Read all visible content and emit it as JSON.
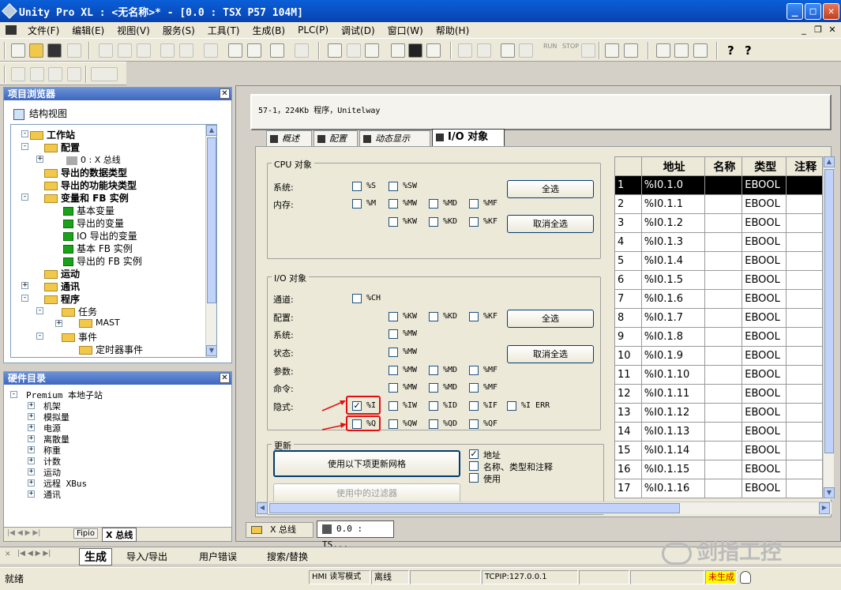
{
  "window": {
    "title": "Unity Pro XL : <无名称>* - [0.0 : TSX P57 104M]",
    "min": "_",
    "max": "□",
    "close": "✕"
  },
  "menu": [
    "文件(F)",
    "编辑(E)",
    "视图(V)",
    "服务(S)",
    "工具(T)",
    "生成(B)",
    "PLC(P)",
    "调试(D)",
    "窗口(W)",
    "帮助(H)"
  ],
  "toolbar": {
    "run_label": "RUN",
    "stop_label": "STOP"
  },
  "project_browser": {
    "title": "项目浏览器",
    "view": "结构视图",
    "items": [
      "工作站",
      "配置",
      "0 : X 总线",
      "导出的数据类型",
      "导出的功能块类型",
      "变量和 FB 实例",
      "基本变量",
      "导出的变量",
      "IO 导出的变量",
      "基本 FB 实例",
      "导出的 FB 实例",
      "运动",
      "通讯",
      "程序",
      "任务",
      "MAST",
      "事件",
      "定时器事件"
    ]
  },
  "hardware_catalog": {
    "title": "硬件目录",
    "root": "Premium 本地子站",
    "items": [
      "机架",
      "模拟量",
      "电源",
      "离散量",
      "称重",
      "计数",
      "运动",
      "远程 XBus",
      "通讯"
    ],
    "tabs": [
      "Fipio",
      "X 总线"
    ]
  },
  "module": {
    "description": "57-1，224Kb 程序，Unitelway",
    "tabs": [
      "概述",
      "配置",
      "动态显示",
      "I/O 对象"
    ]
  },
  "cpu_objects": {
    "title": "CPU 对象",
    "system_label": "系统:",
    "memory_label": "内存:",
    "sys_boxes": [
      "%S",
      "%SW"
    ],
    "mem_row1": [
      "%M",
      "%MW",
      "%MD",
      "%MF"
    ],
    "mem_row2": [
      "%KW",
      "%KD",
      "%KF"
    ],
    "select_all": "全选",
    "deselect_all": "取消全选"
  },
  "io_objects": {
    "title": "I/O 对象",
    "labels": [
      "通道:",
      "配置:",
      "系统:",
      "状态:",
      "参数:",
      "命令:",
      "隐式:"
    ],
    "channel": [
      "%CH"
    ],
    "config": [
      "%KW",
      "%KD",
      "%KF"
    ],
    "system": [
      "%MW"
    ],
    "state": [
      "%MW"
    ],
    "param": [
      "%MW",
      "%MD",
      "%MF"
    ],
    "command": [
      "%MW",
      "%MD",
      "%MF"
    ],
    "implicit1": [
      "%I",
      "%IW",
      "%ID",
      "%IF",
      "%I ERR"
    ],
    "implicit2": [
      "%Q",
      "%QW",
      "%QD",
      "%QF"
    ],
    "select_all": "全选",
    "deselect_all": "取消全选"
  },
  "update": {
    "title": "更新",
    "update_button": "使用以下项更新网格",
    "filter_button": "使用中的过滤器",
    "options": [
      "地址",
      "名称、类型和注释",
      "使用"
    ]
  },
  "grid": {
    "headers": [
      "",
      "地址",
      "名称",
      "类型",
      "注释"
    ],
    "rows": [
      [
        "1",
        "%I0.1.0",
        "",
        "EBOOL"
      ],
      [
        "2",
        "%I0.1.1",
        "",
        "EBOOL"
      ],
      [
        "3",
        "%I0.1.2",
        "",
        "EBOOL"
      ],
      [
        "4",
        "%I0.1.3",
        "",
        "EBOOL"
      ],
      [
        "5",
        "%I0.1.4",
        "",
        "EBOOL"
      ],
      [
        "6",
        "%I0.1.5",
        "",
        "EBOOL"
      ],
      [
        "7",
        "%I0.1.6",
        "",
        "EBOOL"
      ],
      [
        "8",
        "%I0.1.7",
        "",
        "EBOOL"
      ],
      [
        "9",
        "%I0.1.8",
        "",
        "EBOOL"
      ],
      [
        "10",
        "%I0.1.9",
        "",
        "EBOOL"
      ],
      [
        "11",
        "%I0.1.10",
        "",
        "EBOOL"
      ],
      [
        "12",
        "%I0.1.11",
        "",
        "EBOOL"
      ],
      [
        "13",
        "%I0.1.12",
        "",
        "EBOOL"
      ],
      [
        "14",
        "%I0.1.13",
        "",
        "EBOOL"
      ],
      [
        "15",
        "%I0.1.14",
        "",
        "EBOOL"
      ],
      [
        "16",
        "%I0.1.15",
        "",
        "EBOOL"
      ],
      [
        "17",
        "%I0.1.16",
        "",
        "EBOOL"
      ]
    ]
  },
  "doc_tabs": [
    "X 总线",
    "0.0 : TS..."
  ],
  "output_tabs": [
    "生成",
    "导入/导出",
    "用户错误",
    "搜索/替换"
  ],
  "watermark": "剑指工控",
  "status": {
    "ready": "就绪",
    "mode": "HMI 读写模式",
    "online": "离线",
    "address": "TCPIP:127.0.0.1",
    "build": "未生成"
  },
  "colors": {
    "title": "#0842b0",
    "panel_header": "#3d66c0",
    "red_box": "#e01010",
    "not_built": "#ffff00"
  }
}
